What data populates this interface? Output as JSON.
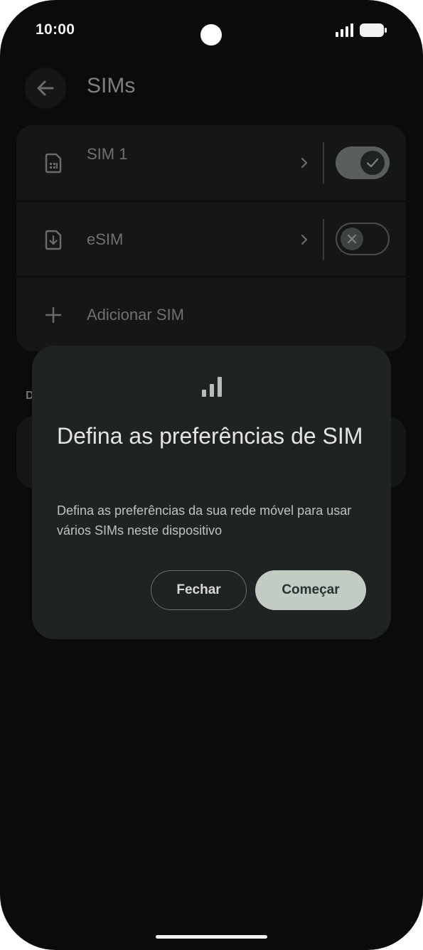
{
  "status_bar": {
    "time": "10:00",
    "icons": [
      "signal-icon",
      "battery-icon"
    ]
  },
  "app_bar": {
    "back_icon": "arrow-back-icon",
    "title": "SIMs"
  },
  "sim_list": {
    "items": [
      {
        "icon": "sim-card-icon",
        "label": "SIM 1",
        "chevron": "chevron-right-icon",
        "toggle_on": true,
        "toggle_icon": "check-icon"
      },
      {
        "icon": "esim-icon",
        "label": "eSIM",
        "chevron": "chevron-right-icon",
        "toggle_on": false,
        "toggle_icon": "close-icon"
      },
      {
        "icon": "plus-icon",
        "label": "Adicionar SIM"
      }
    ]
  },
  "background_section": {
    "label_fragment": "D"
  },
  "dialog": {
    "icon": "signal-bars-icon",
    "title": "Defina as preferências de SIM",
    "body": "Defina as preferências da sua rede móvel para usar vários SIMs neste dispositivo",
    "close_label": "Fechar",
    "start_label": "Começar"
  },
  "colors": {
    "background": "#0b0b0b",
    "surface": "#151616",
    "dialog_surface": "#202323",
    "primary_button": "#c3cbc5",
    "primary_button_text": "#283230"
  }
}
